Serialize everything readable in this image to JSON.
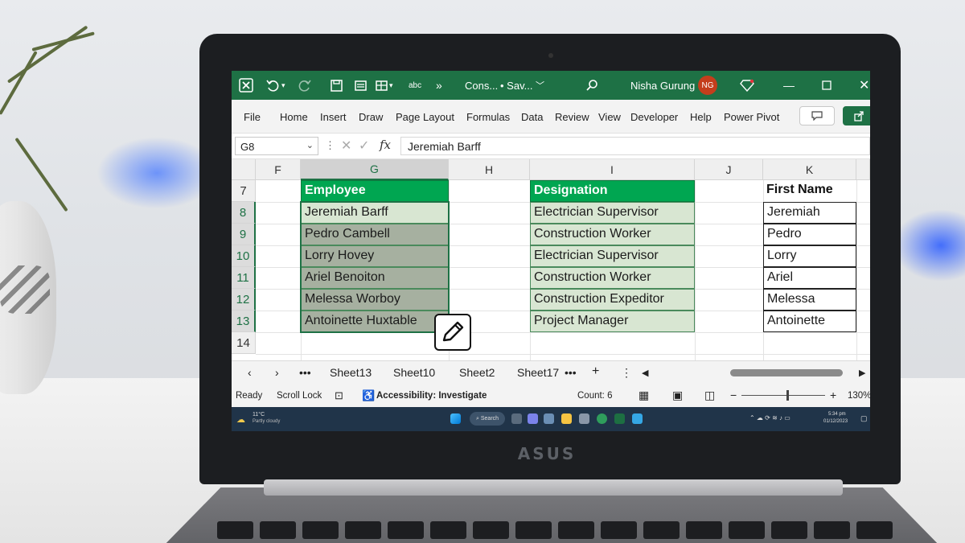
{
  "titlebar": {
    "doc_name": "Cons...",
    "save_status": "• Sav...",
    "user_name": "Nisha Gurung",
    "user_initials": "NG"
  },
  "ribbon": {
    "tabs": [
      "File",
      "Home",
      "Insert",
      "Draw",
      "Page Layout",
      "Formulas",
      "Data",
      "Review",
      "View",
      "Developer",
      "Help",
      "Power Pivot"
    ]
  },
  "formula_bar": {
    "name_box": "G8",
    "fx_label": "fx",
    "content": "Jeremiah Barff"
  },
  "grid": {
    "columns": [
      "F",
      "G",
      "H",
      "I",
      "J",
      "K"
    ],
    "rows": [
      "7",
      "8",
      "9",
      "10",
      "11",
      "12",
      "13",
      "14"
    ],
    "employee_header": "Employee",
    "employees": [
      "Jeremiah Barff",
      "Pedro Cambell",
      "Lorry Hovey",
      "Ariel Benoiton",
      "Melessa Worboy",
      "Antoinette Huxtable"
    ],
    "designation_header": "Designation",
    "designations": [
      "Electrician Supervisor",
      "Construction Worker",
      "Electrician Supervisor",
      "Construction Worker",
      "Construction Expeditor",
      "Project Manager"
    ],
    "first_name_header": "First Name",
    "first_names": [
      "Jeremiah",
      "Pedro",
      "Lorry",
      "Ariel",
      "Melessa",
      "Antoinette"
    ]
  },
  "sheet_tabs": {
    "more": "•••",
    "tabs": [
      "Sheet13",
      "Sheet10",
      "Sheet2",
      "Sheet17"
    ],
    "add": "+",
    "options": "⋮"
  },
  "status_bar": {
    "ready": "Ready",
    "scroll_lock": "Scroll Lock",
    "accessibility": "Accessibility: Investigate",
    "count": "Count: 6",
    "zoom_minus": "−",
    "zoom_plus": "+",
    "zoom": "130%"
  },
  "taskbar": {
    "weather_temp": "11°C",
    "weather_desc": "Partly cloudy",
    "search_label": "Search",
    "time": "5:34 pm",
    "date": "01/12/2023"
  },
  "laptop": {
    "brand": "ASUS"
  },
  "colors": {
    "excel_green": "#1e7145",
    "header_green": "#00a651",
    "light_green_fill": "#d8e6d2",
    "selection_fill": "#a6b0a0"
  }
}
